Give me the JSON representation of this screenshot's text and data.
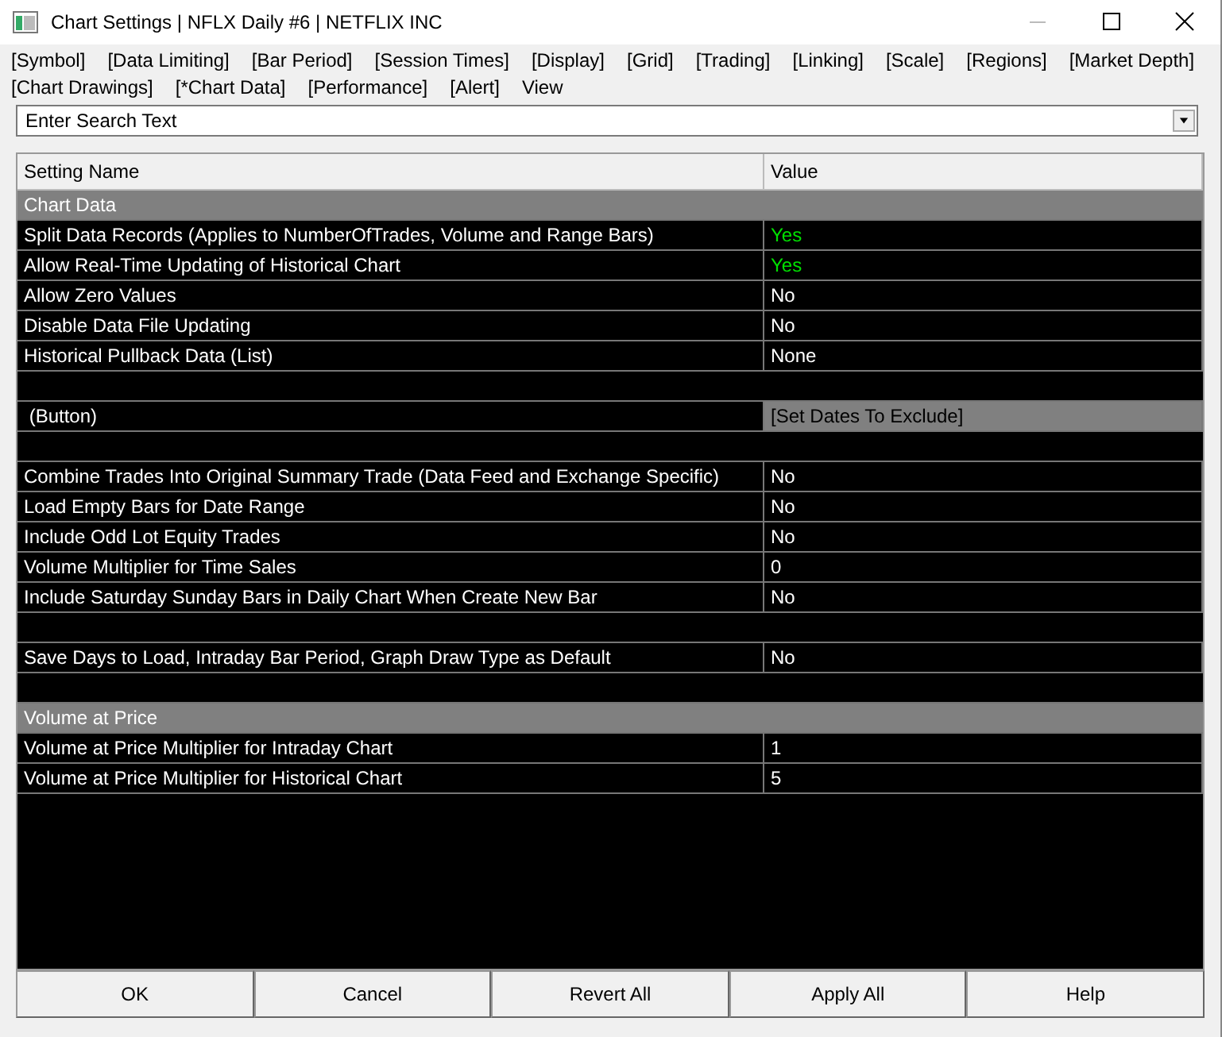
{
  "window": {
    "title": "Chart Settings | NFLX  Daily #6 | NETFLIX INC"
  },
  "tabs": [
    "[Symbol]",
    "[Data Limiting]",
    "[Bar Period]",
    "[Session Times]",
    "[Display]",
    "[Grid]",
    "[Trading]",
    "[Linking]",
    "[Scale]",
    "[Regions]",
    "[Market Depth]",
    "[Chart Drawings]",
    "[*Chart Data]",
    "[Performance]",
    "[Alert]",
    "View"
  ],
  "search": {
    "placeholder": "Enter Search Text"
  },
  "table": {
    "columns": [
      "Setting Name",
      "Value"
    ],
    "rows": [
      {
        "kind": "section",
        "name": "Chart Data"
      },
      {
        "kind": "setting",
        "name": "Split Data Records (Applies to NumberOfTrades, Volume and Range Bars)",
        "value": "Yes",
        "color": "#00e000"
      },
      {
        "kind": "setting",
        "name": "Allow Real-Time Updating of Historical Chart",
        "value": "Yes",
        "color": "#00e000"
      },
      {
        "kind": "setting",
        "name": "Allow Zero Values",
        "value": "No",
        "color": "#ffffff"
      },
      {
        "kind": "setting",
        "name": "Disable Data File Updating",
        "value": "No",
        "color": "#ffffff"
      },
      {
        "kind": "setting",
        "name": "Historical Pullback Data (List)",
        "value": "None",
        "color": "#ffffff"
      },
      {
        "kind": "blank"
      },
      {
        "kind": "button",
        "name": " (Button)",
        "value": "[Set Dates To Exclude]"
      },
      {
        "kind": "blank"
      },
      {
        "kind": "setting",
        "name": "Combine Trades Into Original Summary Trade (Data Feed and Exchange Specific)",
        "value": "No",
        "color": "#ffffff"
      },
      {
        "kind": "setting",
        "name": "Load Empty Bars for Date Range",
        "value": "No",
        "color": "#ffffff"
      },
      {
        "kind": "setting",
        "name": "Include Odd Lot Equity Trades",
        "value": "No",
        "color": "#ffffff"
      },
      {
        "kind": "setting",
        "name": "Volume Multiplier for Time Sales",
        "value": "0",
        "color": "#ffffff"
      },
      {
        "kind": "setting",
        "name": "Include Saturday Sunday Bars in Daily Chart When Create New Bar",
        "value": "No",
        "color": "#ffffff"
      },
      {
        "kind": "blank"
      },
      {
        "kind": "setting",
        "name": "Save Days to Load, Intraday Bar Period, Graph Draw Type as Default",
        "value": "No",
        "color": "#ffffff"
      },
      {
        "kind": "blank"
      },
      {
        "kind": "section",
        "name": "Volume at Price"
      },
      {
        "kind": "setting",
        "name": "Volume at Price Multiplier for Intraday Chart",
        "value": "1",
        "color": "#ffffff"
      },
      {
        "kind": "setting",
        "name": "Volume at Price Multiplier for Historical Chart",
        "value": "5",
        "color": "#ffffff"
      }
    ]
  },
  "buttons": [
    "OK",
    "Cancel",
    "Revert All",
    "Apply All",
    "Help"
  ]
}
